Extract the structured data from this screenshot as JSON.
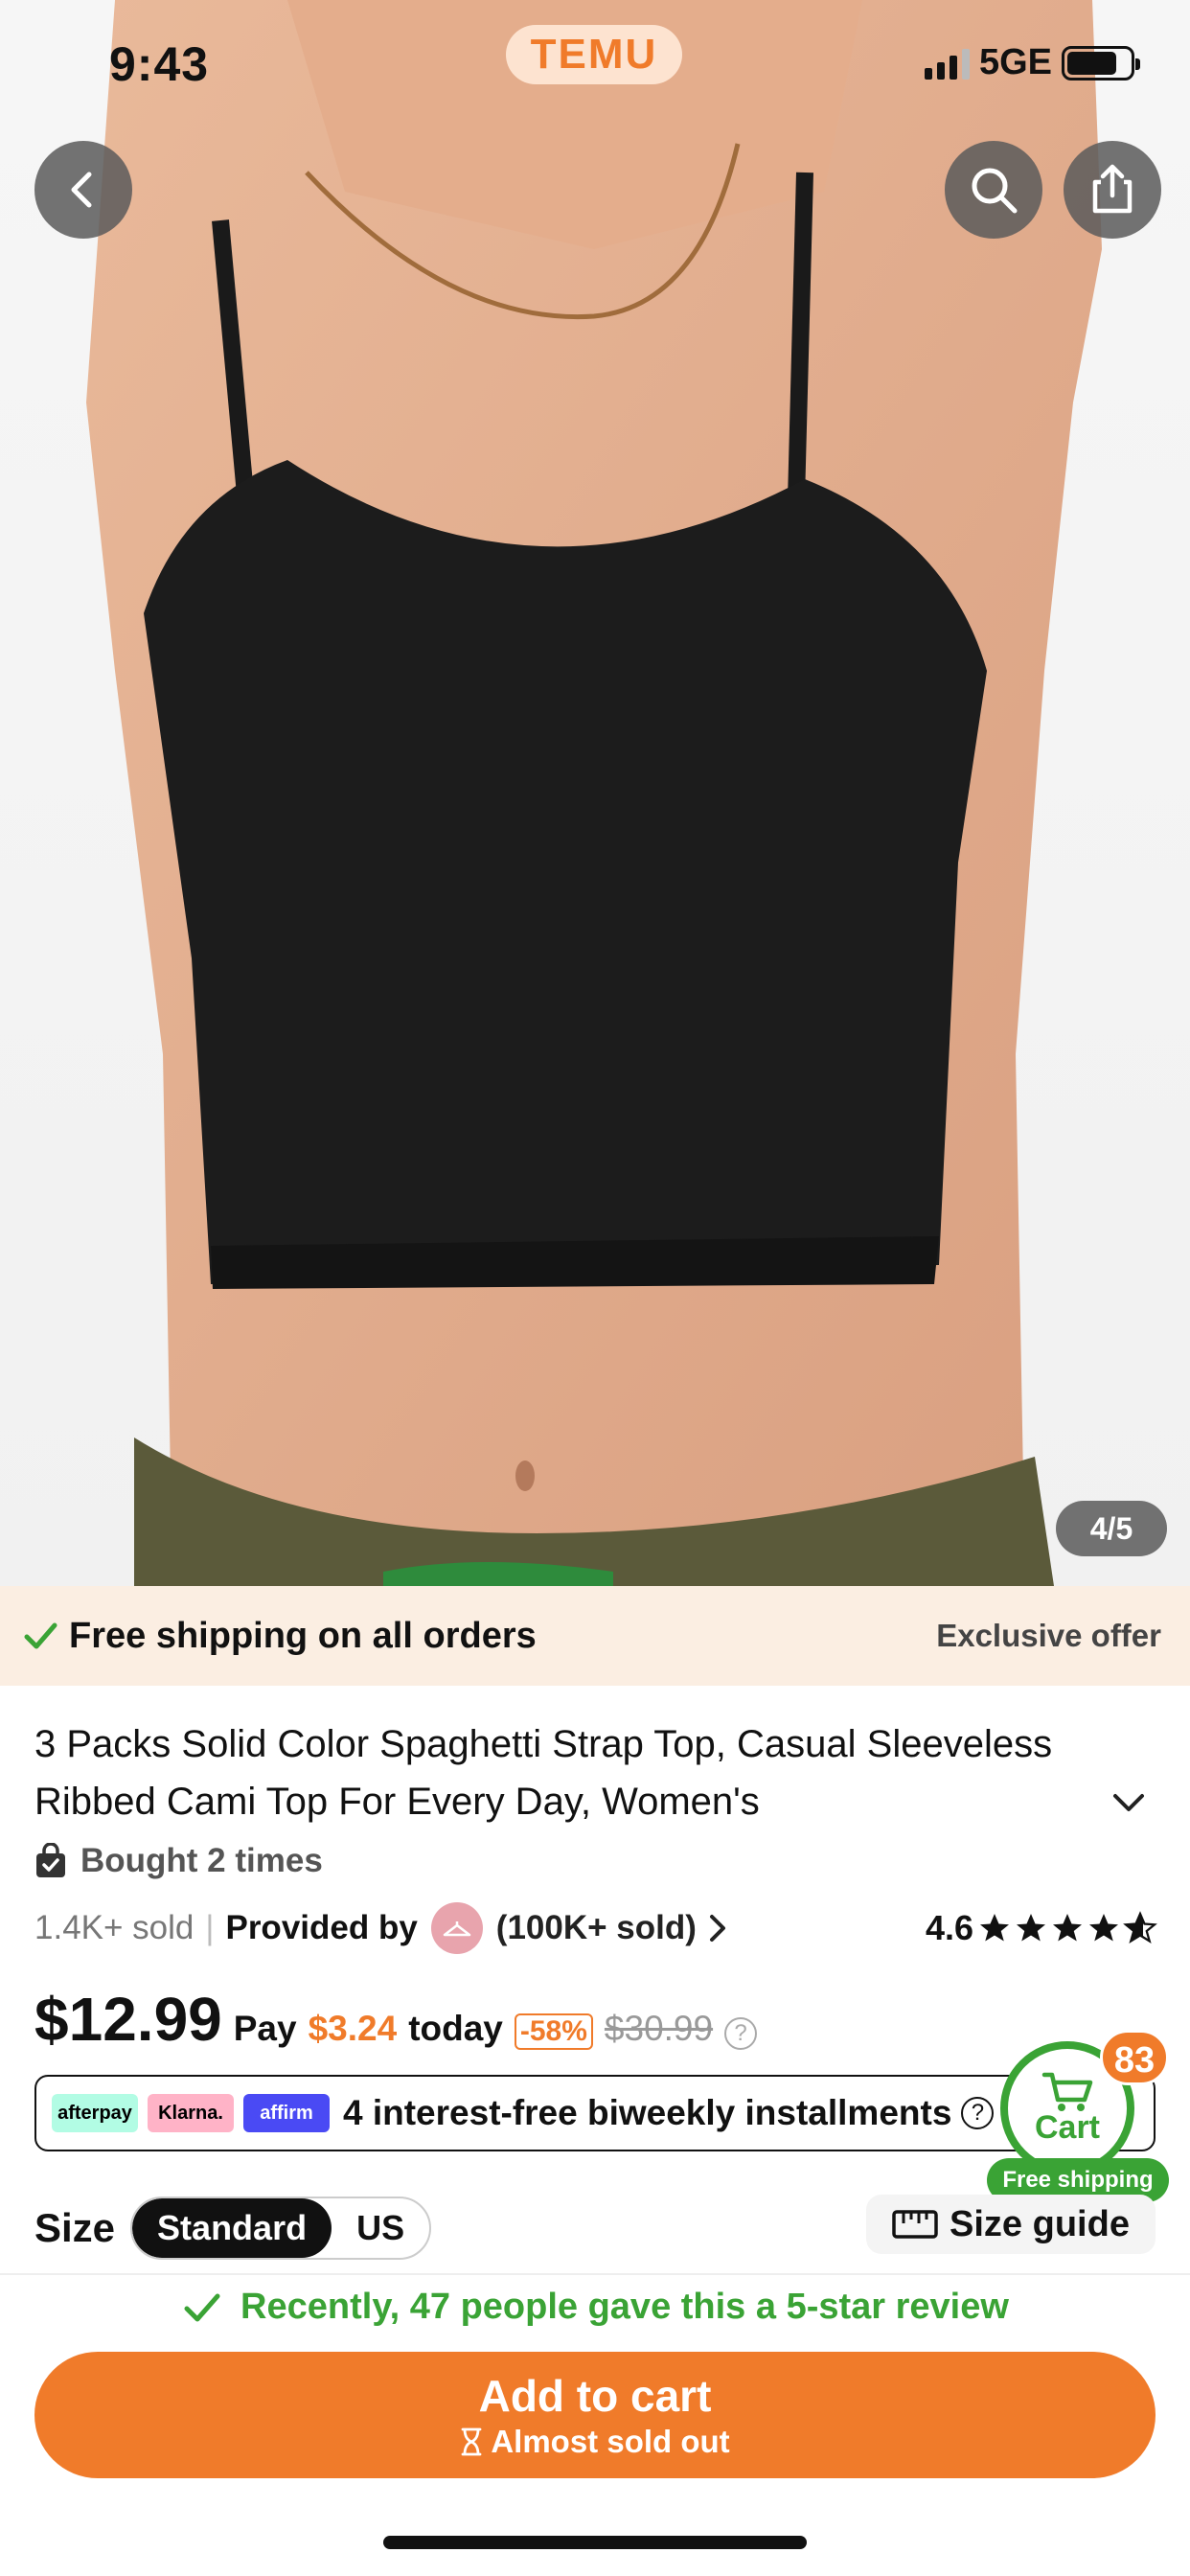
{
  "status_bar": {
    "time": "9:43",
    "network": "5GE",
    "brand": "TEMU"
  },
  "hero": {
    "image_counter": "4/5"
  },
  "shipping_banner": {
    "left_text": "Free shipping on all orders",
    "right_text": "Exclusive offer"
  },
  "product": {
    "title": "3 Packs Solid Color Spaghetti Strap Top, Casual Sleeveless Ribbed Cami Top For Every Day, Women's",
    "bought": "Bought 2 times",
    "sold": "1.4K+ sold",
    "separator": "|",
    "provided_by": "Provided by",
    "store_sold": "(100K+ sold)",
    "rating": "4.6",
    "rating_stars": 4.6
  },
  "pricing": {
    "price": "$12.99",
    "pay_label": "Pay",
    "pay_today_amount": "$3.24",
    "today_label": "today",
    "discount": "-58%",
    "original_price": "$30.99",
    "help": "?"
  },
  "installments": {
    "logos": [
      "afterpay",
      "Klarna.",
      "affirm"
    ],
    "text": "4 interest-free biweekly installments",
    "help": "?"
  },
  "cart": {
    "label": "Cart",
    "count": "83",
    "free_shipping": "Free shipping"
  },
  "size": {
    "label": "Size",
    "options": [
      "Standard",
      "US"
    ],
    "selected": "Standard",
    "guide": "Size guide"
  },
  "review_note": "Recently, 47 people gave this a 5-star review",
  "add_to_cart": {
    "label": "Add to cart",
    "sub": "Almost sold out"
  },
  "colors": {
    "accent": "#f07b2a",
    "green": "#3aa335",
    "banner": "#fbeee2"
  }
}
